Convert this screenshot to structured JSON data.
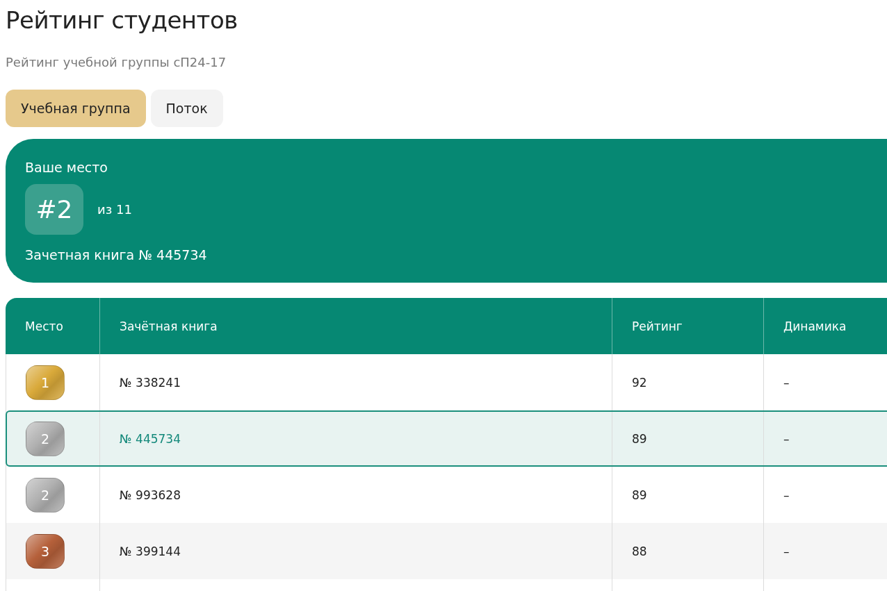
{
  "title": "Рейтинг студентов",
  "subtitle": "Рейтинг учебной группы сП24-17",
  "tabs": [
    {
      "label": "Учебная группа",
      "selected": true
    },
    {
      "label": "Поток",
      "selected": false
    }
  ],
  "your_place": {
    "label": "Ваше место",
    "place": "#2",
    "total": "из 11",
    "record_book": "Зачетная книга № 445734"
  },
  "table": {
    "columns": [
      "Место",
      "Зачётная книга",
      "Рейтинг",
      "Динамика"
    ],
    "rows": [
      {
        "place": "1",
        "color": "#d9a93a",
        "record_book": "№ 338241",
        "rating": "92",
        "dynamics": "–",
        "selected": false
      },
      {
        "place": "2",
        "color": "#b0b0b0",
        "record_book": "№ 445734",
        "rating": "89",
        "dynamics": "–",
        "selected": true
      },
      {
        "place": "2",
        "color": "#b0b0b0",
        "record_book": "№ 993628",
        "rating": "89",
        "dynamics": "–",
        "selected": false
      },
      {
        "place": "3",
        "color": "#b5603a",
        "record_book": "№ 399144",
        "rating": "88",
        "dynamics": "–",
        "selected": false
      }
    ]
  }
}
